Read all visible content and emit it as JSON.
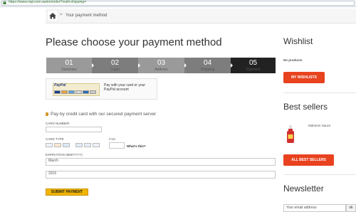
{
  "browser": {
    "url": "https://www.naji.com.au/en/order?multi-shipping="
  },
  "breadcrumb": {
    "current": "Your payment method",
    "separator": ">"
  },
  "page_title": "Please choose your payment method",
  "steps": [
    {
      "num": "01",
      "label": "Summary",
      "color": "#9a9a9a"
    },
    {
      "num": "02",
      "label": "Login",
      "color": "#7d7d7d"
    },
    {
      "num": "03",
      "label": "Address",
      "color": "#9a9a9a"
    },
    {
      "num": "04",
      "label": "Shipping",
      "color": "#7d7d7d"
    },
    {
      "num": "05",
      "label": "Payment",
      "color": "#222222"
    }
  ],
  "paypal": {
    "logo": "PayPal",
    "text": "Pay with your card or your PayPal account"
  },
  "secure_heading": "Pay by credit card with our secured payment server",
  "form": {
    "card_number_label": "CARD NUMBER",
    "card_type_label": "CARD TYPE",
    "cvc_label": "CVC",
    "whats_this": "What's this?",
    "expiration_label": "EXPIRATION (MM/YYYY)",
    "month_value": "March",
    "year_value": "2015",
    "submit": "SUBMIT PAYMENT"
  },
  "sidebar": {
    "wishlist_title": "Wishlist",
    "wishlist_empty": "No products",
    "wishlist_button": "MY WISHLISTS",
    "bestsellers_title": "Best sellers",
    "bestseller_item": "Mahnem Sauce",
    "bestsellers_button": "ALL BEST SELLERS",
    "newsletter_title": "Newsletter",
    "newsletter_placeholder": "Your email address",
    "newsletter_button": "ok"
  },
  "colors": {
    "accent_red": "#e8421f",
    "submit_yellow": "#f0b400"
  }
}
